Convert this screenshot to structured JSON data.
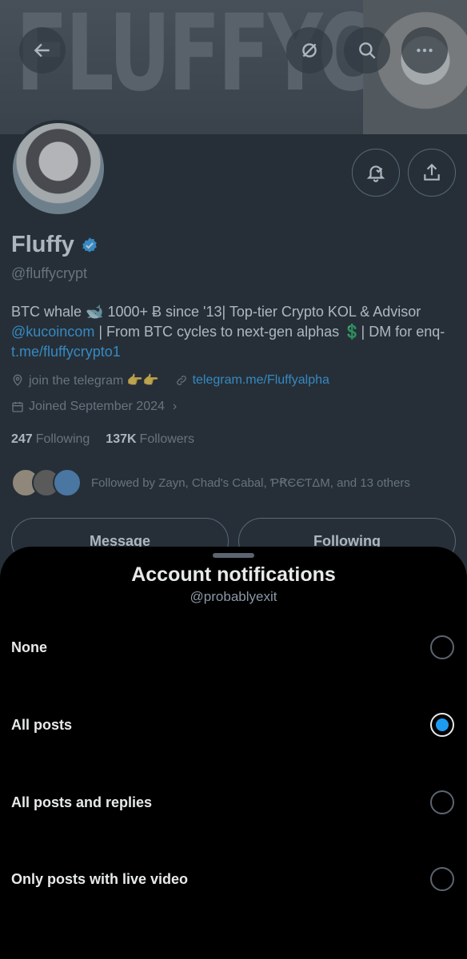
{
  "banner": {
    "text": "FLUFFYCRYPT"
  },
  "profile": {
    "name": "Fluffy",
    "handle": "@fluffycrypt",
    "bio_line1": "BTC whale 🐋 1000+ Ƀ since '13| Top-tier Crypto KOL & Advisor",
    "bio_mention": "@kucoincom",
    "bio_line2_rest": " | From BTC cycles to next-gen alphas 💲| DM for enq-",
    "bio_link": "t.me/fluffycrypto1",
    "location": "join the telegram 👉👉",
    "website": "telegram.me/Fluffyalpha",
    "joined": "Joined September 2024",
    "following_count": "247",
    "following_label": "Following",
    "followers_count": "137K",
    "followers_label": "Followers",
    "followed_by": "Followed by Zayn, Chad's Cabal, ƤꞦЄЄƬΔM, and 13 others",
    "message_label": "Message",
    "following_button_label": "Following"
  },
  "sheet": {
    "title": "Account notifications",
    "subtitle": "@probablyexit",
    "options": [
      {
        "label": "None",
        "selected": false
      },
      {
        "label": "All posts",
        "selected": true
      },
      {
        "label": "All posts and replies",
        "selected": false
      },
      {
        "label": "Only posts with live video",
        "selected": false
      }
    ]
  },
  "colors": {
    "accent": "#1d9bf0",
    "background": "#000000",
    "muted": "#71767b"
  },
  "icons": [
    "back-arrow-icon",
    "hide-icon",
    "search-icon",
    "more-icon",
    "notification-bell-icon",
    "share-icon",
    "verified-badge-icon",
    "location-icon",
    "link-icon",
    "calendar-icon"
  ]
}
